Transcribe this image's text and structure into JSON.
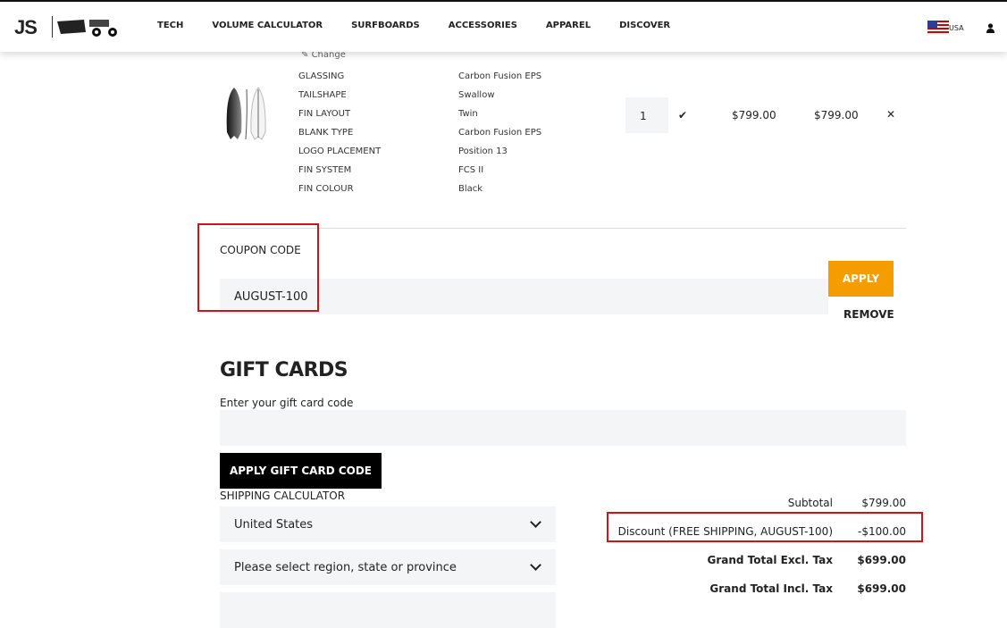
{
  "header": {
    "logo": "JS",
    "nav": [
      "TECH",
      "VOLUME CALCULATOR",
      "SURFBOARDS",
      "ACCESSORIES",
      "APPAREL",
      "DISCOVER"
    ],
    "country": "USA"
  },
  "item": {
    "change": "Change",
    "options": [
      [
        "GLASSING",
        "Carbon Fusion EPS"
      ],
      [
        "TAILSHAPE",
        "Swallow"
      ],
      [
        "FIN LAYOUT",
        "Twin"
      ],
      [
        "BLANK TYPE",
        "Carbon Fusion EPS"
      ],
      [
        "LOGO PLACEMENT",
        "Position 13"
      ],
      [
        "FIN SYSTEM",
        "FCS II"
      ],
      [
        "FIN COLOUR",
        "Black"
      ]
    ],
    "qty": "1",
    "price": "$799.00",
    "row_total": "$799.00"
  },
  "coupon": {
    "label": "COUPON CODE",
    "value": "AUGUST-100",
    "apply": "APPLY",
    "remove": "REMOVE"
  },
  "gift": {
    "title": "GIFT CARDS",
    "label": "Enter your gift card code",
    "value": "",
    "button": "APPLY GIFT CARD CODE"
  },
  "shipping": {
    "label": "SHIPPING CALCULATOR",
    "country": "United States",
    "region": "Please select region, state or province"
  },
  "totals": {
    "subtotal_label": "Subtotal",
    "subtotal": "$799.00",
    "discount_label": "Discount (FREE SHIPPING, AUGUST-100)",
    "discount": "-$100.00",
    "excl_label": "Grand Total Excl. Tax",
    "excl": "$699.00",
    "incl_label": "Grand Total Incl. Tax",
    "incl": "$699.00"
  },
  "colors": {
    "accent": "#f59c00",
    "highlight": "#d0131b"
  }
}
